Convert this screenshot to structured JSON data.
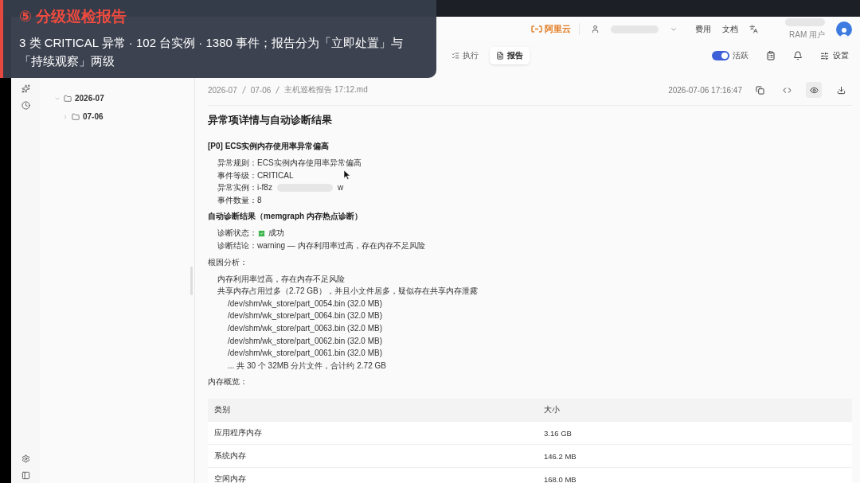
{
  "caption": {
    "title": "⑤ 分级巡检报告",
    "text": "3 类 CRITICAL 异常 · 102 台实例 · 1380 事件；报告分为「立即处置」与「持续观察」两级"
  },
  "header": {
    "logo": "阿里云",
    "links": [
      "费用",
      "文档"
    ],
    "account_role": "RAM 用户"
  },
  "toolbar": {
    "tabs": [
      {
        "label": "执行",
        "kind": "run",
        "selected": false
      },
      {
        "label": "报告",
        "kind": "report",
        "selected": true
      }
    ],
    "status_toggle": {
      "label": "活跃",
      "on": true
    },
    "settings": "设置"
  },
  "sidebar": {
    "tree": [
      {
        "label": "2026-07",
        "expanded": true,
        "children": [
          {
            "label": "07-06",
            "expanded": false
          }
        ]
      }
    ]
  },
  "breadcrumb": [
    "2026-07",
    "07-06",
    "主机巡检报告 17:12.md"
  ],
  "timestamp": "2026-07-06 17:16:47",
  "view_actions": [
    {
      "kind": "copy",
      "selected": false
    },
    {
      "kind": "code",
      "selected": false
    },
    {
      "kind": "preview",
      "selected": true
    },
    {
      "kind": "download",
      "selected": false
    }
  ],
  "report": {
    "heading": "异常项详情与自动诊断结果",
    "blocks": [
      {
        "kind": "subheading",
        "text": "[P0] ECS实例内存使用率异常偏高"
      },
      {
        "kind": "field",
        "label": "异常规则：",
        "value": "ECS实例内存使用率异常偏高"
      },
      {
        "kind": "field",
        "label": "事件等级：",
        "value": "CRITICAL"
      },
      {
        "kind": "redacted",
        "label": "异常实例：",
        "value": "i-f8z",
        "tail": "w"
      },
      {
        "kind": "field",
        "label": "事件数量：",
        "value": "8"
      },
      {
        "kind": "subheading",
        "text": "自动诊断结果（memgraph 内存热点诊断）"
      },
      {
        "kind": "status",
        "label": "诊断状态：",
        "value": "成功",
        "checked": true
      },
      {
        "kind": "field",
        "label": "诊断结论：",
        "value": "warning — 内存利用率过高，存在内存不足风险"
      },
      {
        "kind": "label",
        "text": "根因分析："
      },
      {
        "kind": "line",
        "text": "内存利用率过高，存在内存不足风险"
      },
      {
        "kind": "line",
        "text": "共享内存占用过多（2.72 GB），并且小文件居多，疑似存在共享内存泄露"
      },
      {
        "kind": "path",
        "text": "/dev/shm/wk_store/part_0054.bin (32.0 MB)"
      },
      {
        "kind": "path",
        "text": "/dev/shm/wk_store/part_0064.bin (32.0 MB)"
      },
      {
        "kind": "path",
        "text": "/dev/shm/wk_store/part_0063.bin (32.0 MB)"
      },
      {
        "kind": "path",
        "text": "/dev/shm/wk_store/part_0062.bin (32.0 MB)"
      },
      {
        "kind": "path",
        "text": "/dev/shm/wk_store/part_0061.bin (32.0 MB)"
      },
      {
        "kind": "path",
        "text": "... 共 30 个 32MB 分片文件，合计约 2.72 GB"
      },
      {
        "kind": "label",
        "text": "内存概览："
      }
    ]
  },
  "table": {
    "columns": [
      "类别",
      "大小"
    ],
    "rows": [
      [
        "应用程序内存",
        "3.16 GB"
      ],
      [
        "系统内存",
        "146.2 MB"
      ],
      [
        "空闲内存",
        "168.0 MB"
      ]
    ]
  }
}
